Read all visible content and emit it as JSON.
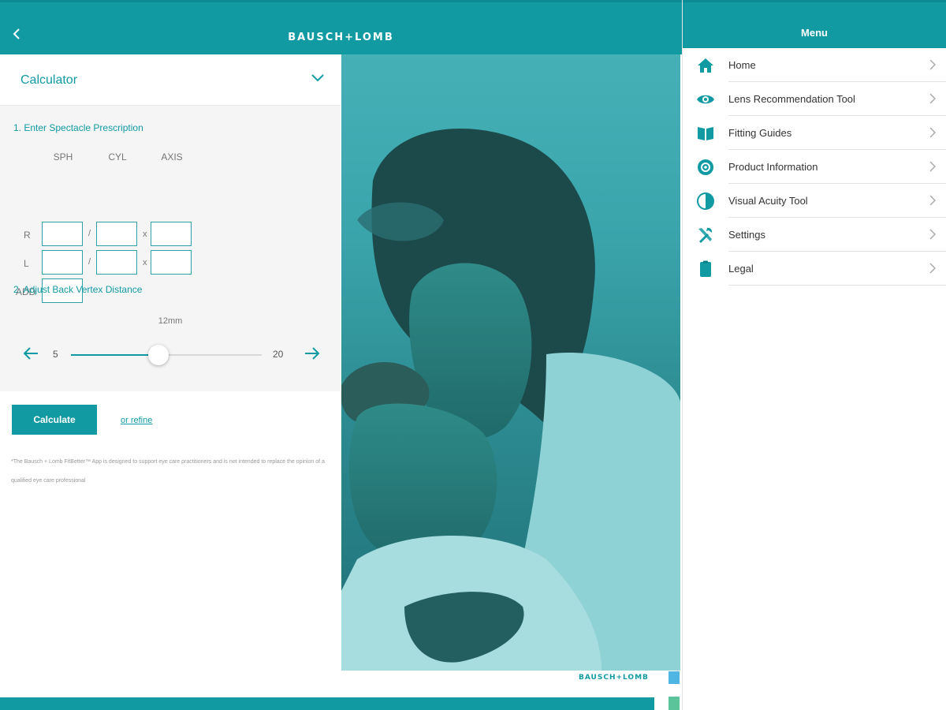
{
  "header": {
    "brand": "BAUSCH+LOMB"
  },
  "calculator": {
    "title": "Calculator",
    "section1_title": "1. Enter Spectacle Prescription",
    "columns": [
      "SPH",
      "CYL",
      "AXIS"
    ],
    "rows": [
      "R",
      "L"
    ],
    "add_label": "ADD",
    "separators": {
      "slash": "/",
      "times": "x"
    },
    "section2_title": "2. Adjust Back Vertex Distance",
    "vertex_value": "12mm",
    "slider": {
      "min": "5",
      "max": "20",
      "min_value": 5,
      "max_value": 20,
      "value": 12
    },
    "calculate_label": "Calculate",
    "refine_label": "or refine",
    "disclaimer": "*The Bausch + Lomb FitBetter™ App is designed to support eye care practitioners and is not intended to replace the opinion of a qualified eye care professional"
  },
  "footer": {
    "brand": "BAUSCH+LOMB"
  },
  "menu": {
    "title": "Menu",
    "items": [
      {
        "label": "Home",
        "icon": "home-icon"
      },
      {
        "label": "Lens Recommendation Tool",
        "icon": "eye-icon"
      },
      {
        "label": "Fitting Guides",
        "icon": "book-icon"
      },
      {
        "label": "Product Information",
        "icon": "product-info-icon"
      },
      {
        "label": "Visual Acuity Tool",
        "icon": "contrast-icon"
      },
      {
        "label": "Settings",
        "icon": "tools-icon"
      },
      {
        "label": "Legal",
        "icon": "clipboard-icon"
      }
    ]
  },
  "colors": {
    "accent": "#129aa3",
    "swatch_blue": "#4fb6e3",
    "swatch_green": "#5cc49a"
  }
}
